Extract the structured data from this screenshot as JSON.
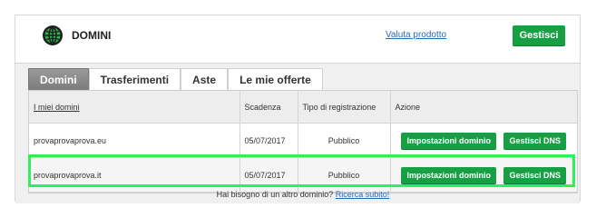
{
  "header": {
    "title": "DOMINI",
    "icon": "globe-icon",
    "valuta_link": "Valuta prodotto",
    "gestisci_button": "Gestisci"
  },
  "tabs": [
    {
      "label": "Domini",
      "active": true
    },
    {
      "label": "Trasferimenti",
      "active": false
    },
    {
      "label": "Aste",
      "active": false
    },
    {
      "label": "Le mie offerte",
      "active": false
    }
  ],
  "table": {
    "columns": [
      "I miei domini",
      "Scadenza",
      "Tipo di registrazione",
      "Azione"
    ],
    "rows": [
      {
        "domain": "provaprovaprova.eu",
        "expiry": "05/07/2017",
        "type": "Pubblico",
        "btn_settings": "Impostazioni dominio",
        "btn_dns": "Gestisci DNS"
      },
      {
        "domain": "provaprovaprova.it",
        "expiry": "05/07/2017",
        "type": "Pubblico",
        "btn_settings": "Impostazioni dominio",
        "btn_dns": "Gestisci DNS"
      }
    ]
  },
  "footer": {
    "text": "Hai bisogno di un altro dominio?",
    "link": "Ricerca subito!"
  },
  "colors": {
    "accent": "#17a043",
    "highlight": "#2ef05a",
    "link": "#2a6ab8"
  }
}
